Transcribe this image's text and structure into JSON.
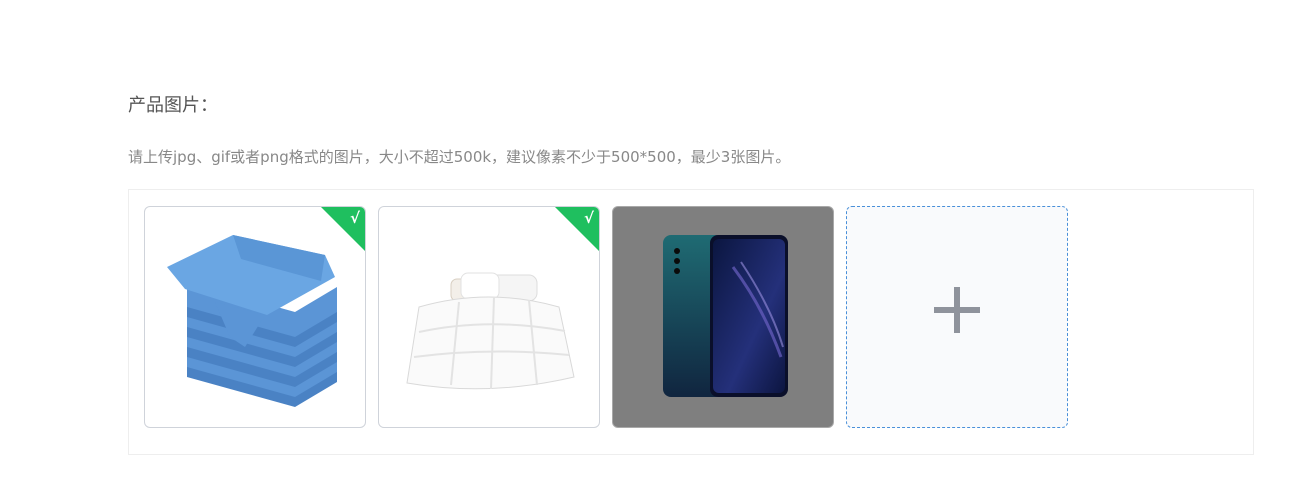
{
  "section": {
    "title": "产品图片：",
    "hint": "请上传jpg、gif或者png格式的图片，大小不超过500k，建议像素不少于500*500，最少3张图片。"
  },
  "images": [
    {
      "label": "towels",
      "selected": true,
      "badge": "√"
    },
    {
      "label": "duvet",
      "selected": true,
      "badge": "√"
    },
    {
      "label": "phone",
      "selected": false
    }
  ],
  "add_button": {
    "icon": "plus-icon"
  },
  "colors": {
    "badge_green": "#1fbf5f",
    "add_border": "#4a90d9",
    "plus": "#8f939c"
  }
}
